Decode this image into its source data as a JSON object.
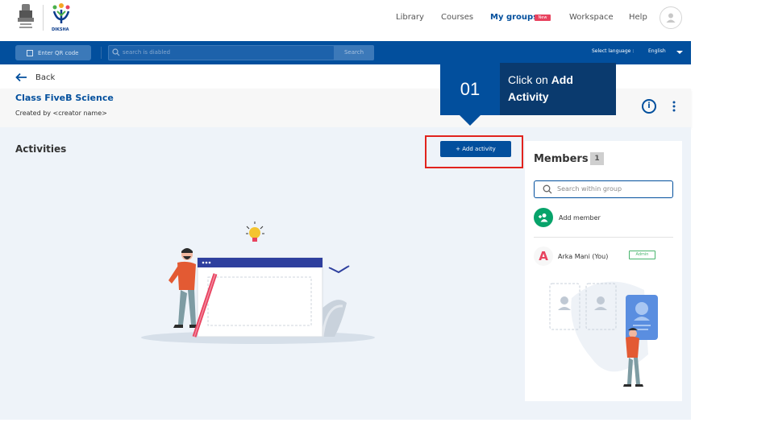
{
  "header": {
    "brand": "DIKSHA",
    "nav": [
      "Library",
      "Courses",
      "My groups",
      "Workspace",
      "Help"
    ],
    "active_nav": "My groups",
    "new_badge": "New"
  },
  "toolbar": {
    "qr_label": "Enter QR code",
    "search_placeholder": "search is diabled",
    "search_button": "Search",
    "language_label": "Select language :",
    "language_value": "English"
  },
  "back_label": "Back",
  "group": {
    "title": "Class FiveB Science",
    "subtitle": "Created by <creator name>"
  },
  "main": {
    "activities_title": "Activities",
    "add_activity_label": "+ Add activity"
  },
  "members": {
    "title": "Members",
    "count": "1",
    "search_placeholder": "Search within group",
    "add_member_label": "Add member",
    "list": [
      {
        "initial": "A",
        "name": "Arka Mani (You)",
        "role": "Admin"
      }
    ]
  },
  "callout": {
    "step": "01",
    "text_prefix": "Click on ",
    "text_bold": "Add Activity"
  },
  "colors": {
    "primary": "#024f9d",
    "callout_dark": "#0a3a6e",
    "highlight": "#e1231d",
    "success": "#07a36a",
    "badge_new": "#e8435f"
  }
}
